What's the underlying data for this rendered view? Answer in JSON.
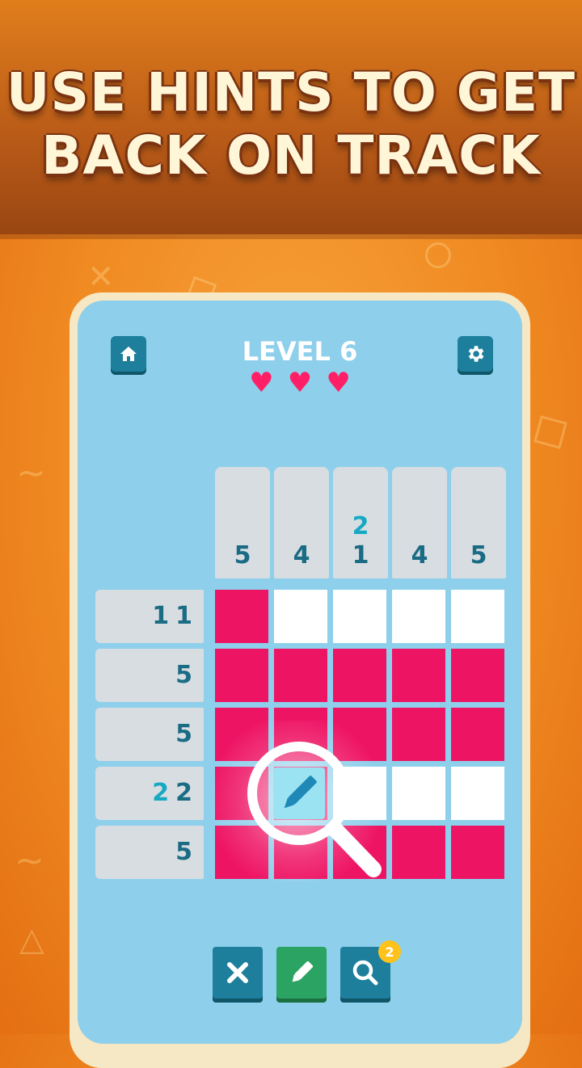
{
  "banner": {
    "line1": "USE HINTS TO GET",
    "line2": "BACK ON TRACK"
  },
  "header": {
    "home_icon": "home-icon",
    "settings_icon": "gear-icon",
    "level_label": "LEVEL 6",
    "lives": 3,
    "heart_icon": "heart-icon"
  },
  "puzzle": {
    "col_clues": [
      [
        "5"
      ],
      [
        "4"
      ],
      [
        "2",
        "1"
      ],
      [
        "4"
      ],
      [
        "5"
      ]
    ],
    "row_clues": [
      [
        "1",
        "1"
      ],
      [
        "5"
      ],
      [
        "5"
      ],
      [
        "2",
        "2"
      ],
      [
        "5"
      ]
    ],
    "grid": [
      [
        1,
        0,
        0,
        0,
        0
      ],
      [
        1,
        1,
        1,
        1,
        1
      ],
      [
        1,
        1,
        1,
        1,
        1
      ],
      [
        1,
        1,
        0,
        0,
        0
      ],
      [
        1,
        1,
        1,
        1,
        1
      ]
    ],
    "highlight_cell": {
      "row": 3,
      "col": 1
    },
    "highlighted_clue": {
      "column": 2,
      "first_number": "2",
      "row": 3,
      "first_row_number": "2"
    }
  },
  "toolbar": {
    "clear_icon": "x-icon",
    "pencil_icon": "pencil-icon",
    "hint_icon": "magnifier-icon",
    "hint_count": "2"
  },
  "colors": {
    "filled": "#ee1464",
    "empty": "#ffffff",
    "clue_bg": "#d8dde2",
    "clue_text": "#1a6b84",
    "board_bg": "#8ecfeb",
    "heart": "#ff1f67",
    "x_button": "#1d7f9b",
    "pencil_button": "#2aa363",
    "hint_button": "#1d7f9b",
    "badge": "#ffc21a"
  }
}
